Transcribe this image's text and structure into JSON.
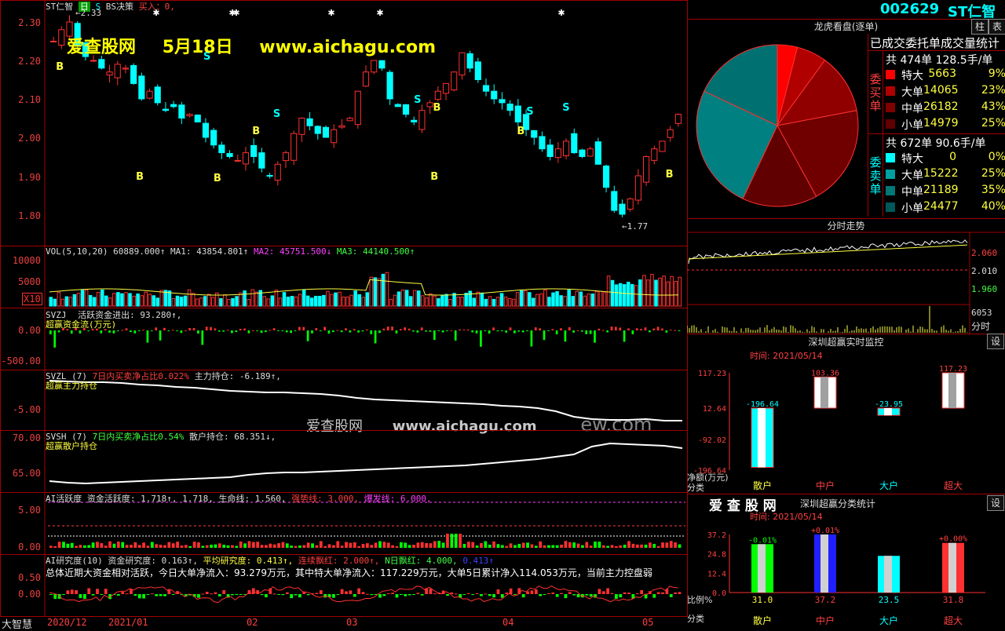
{
  "stock": {
    "code": "002629",
    "name": "ST仁智"
  },
  "main_chart": {
    "header_stock": "ST仁智",
    "header_badge_1": "日",
    "header_badge_2": "S",
    "header_high": "2.33",
    "header_strategy": "BS决策",
    "header_buy": "买入：0,",
    "low_mark": "1.77",
    "yticks": [
      "2.30",
      "2.20",
      "2.10",
      "2.00",
      "1.90",
      "1.80"
    ],
    "signal_b": "B",
    "signal_s": "S"
  },
  "watermark": {
    "site_name": "爱查股网",
    "date": "5月18日",
    "url": "www.aichagu.com",
    "mid_name": "爱查股网",
    "mid_url": "www.aichagu.com",
    "mid_tail": "ew.com"
  },
  "vol_panel": {
    "title": "VOL(5,10,20)",
    "value": "60889.000↑",
    "ma1": "MA1: 43854.801↑",
    "ma2": "MA2: 45751.500↓",
    "ma3": "MA3: 44140.500↑",
    "yticks": [
      "10000",
      "5000"
    ],
    "unit": "X10"
  },
  "svzj_panel": {
    "title": "SVZJ",
    "line1": "活跃资金进出: 93.280↑,",
    "line2": "超赢资金流(万元)",
    "yticks": [
      "0.00",
      "-500.00"
    ]
  },
  "svzl_panel": {
    "title": "SVZL (7)",
    "ratio": "7日内买卖净占比0.022%",
    "hold": "主力持仓: -6.189↑,",
    "line2": "超赢主力持仓",
    "yticks": [
      "-5.00"
    ]
  },
  "svsh_panel": {
    "title": "SVSH (7)",
    "ratio": "7日内买卖净占比0.54%",
    "hold": "散户持仓: 68.351↓,",
    "line2": "超赢散户持仓",
    "yticks": [
      "70.00",
      "65.00"
    ]
  },
  "ai_active_panel": {
    "title": "AI活跃度",
    "fund": "资金活跃度: 1.718↑, 1.718,",
    "life": "生命线: 1.560,",
    "strong": "强势线: 3.000,",
    "burst": "爆发线: 6.000,",
    "yticks": [
      "5.00",
      "0.00"
    ]
  },
  "ai_research_panel": {
    "title": "AI研究度(10)",
    "fund": "资金研究度: 0.163↑,",
    "avg": "平均研究度: 0.413↑,",
    "cont": "连续飘红: 2.000↑,",
    "nday": "N日飘红: 4.000,",
    "val": "0.413↑",
    "summary": "总体近期大资金相对活跃，今日大单净流入：93.279万元，其中特大单净流入：117.229万元，大单5日累计净入114.053万元，当前主力控盘弱",
    "yticks": [
      "0.50",
      "0.00"
    ]
  },
  "xaxis": {
    "brand": "大智慧",
    "labels": [
      "2020/12",
      "2021/01",
      "02",
      "03",
      "04",
      "05"
    ]
  },
  "dragon_tiger": {
    "title": "龙虎看盘(逐单)",
    "tab_label": "柱",
    "tab_label_2": "表",
    "stats_title": "已成交委托单成交量统计",
    "buy_label": "委买单",
    "sell_label": "委卖单",
    "buy": {
      "total": "共 474单 128.5手/单",
      "rows": [
        {
          "name": "特大",
          "vol": "5663",
          "pct": "9%",
          "color": "#ff0000"
        },
        {
          "name": "大单",
          "vol": "14065",
          "pct": "23%",
          "color": "#b00000"
        },
        {
          "name": "中单",
          "vol": "26182",
          "pct": "43%",
          "color": "#800000"
        },
        {
          "name": "小单",
          "vol": "14979",
          "pct": "25%",
          "color": "#600000"
        }
      ]
    },
    "sell": {
      "total": "共 672单 90.6手/单",
      "rows": [
        {
          "name": "特大",
          "vol": "0",
          "pct": "0%",
          "color": "#00ffff"
        },
        {
          "name": "大单",
          "vol": "15222",
          "pct": "25%",
          "color": "#00a0a0"
        },
        {
          "name": "中单",
          "vol": "21189",
          "pct": "35%",
          "color": "#007878"
        },
        {
          "name": "小单",
          "vol": "24477",
          "pct": "40%",
          "color": "#005858"
        }
      ]
    }
  },
  "intraday": {
    "title": "分时走势",
    "yticks": [
      "2.060",
      "2.010",
      "1.960"
    ],
    "vol_label": "6053",
    "vol_unit": "分时"
  },
  "monitor": {
    "title": "深圳超赢实时监控",
    "gear_label": "设",
    "time": "时间: 2021/05/14",
    "yticks": [
      "117.23",
      "12.64",
      "-92.02",
      "-196.64"
    ],
    "unit": "净额(万元)",
    "cat_label": "分类",
    "chart_data": {
      "type": "bar",
      "categories": [
        "散户",
        "中户",
        "大户",
        "超大"
      ],
      "values": [
        -196.64,
        103.36,
        -23.95,
        117.23
      ],
      "labels": [
        "-196.64",
        "103.36",
        "-23.95",
        "117.23"
      ],
      "ylim": [
        -196.64,
        117.23
      ]
    }
  },
  "classify": {
    "brand": "爱 查 股 网",
    "title": "深圳超赢分类统计",
    "gear_label": "设",
    "time": "时间: 2021/05/14",
    "yticks": [
      "37.2",
      "24.8",
      "12.4",
      "0.0"
    ],
    "ratio_label": "比例%",
    "cat_label": "分类",
    "chart_data": {
      "type": "bar",
      "categories": [
        "散户",
        "中户",
        "大户",
        "超大"
      ],
      "values": [
        31.0,
        37.2,
        23.5,
        31.8
      ],
      "top_labels": [
        "-0.01%",
        "+0.01%",
        "",
        "+0.00%"
      ],
      "value_labels": [
        "31.0",
        "37.2",
        "23.5",
        "31.8"
      ],
      "ylim": [
        0,
        37.2
      ]
    }
  }
}
